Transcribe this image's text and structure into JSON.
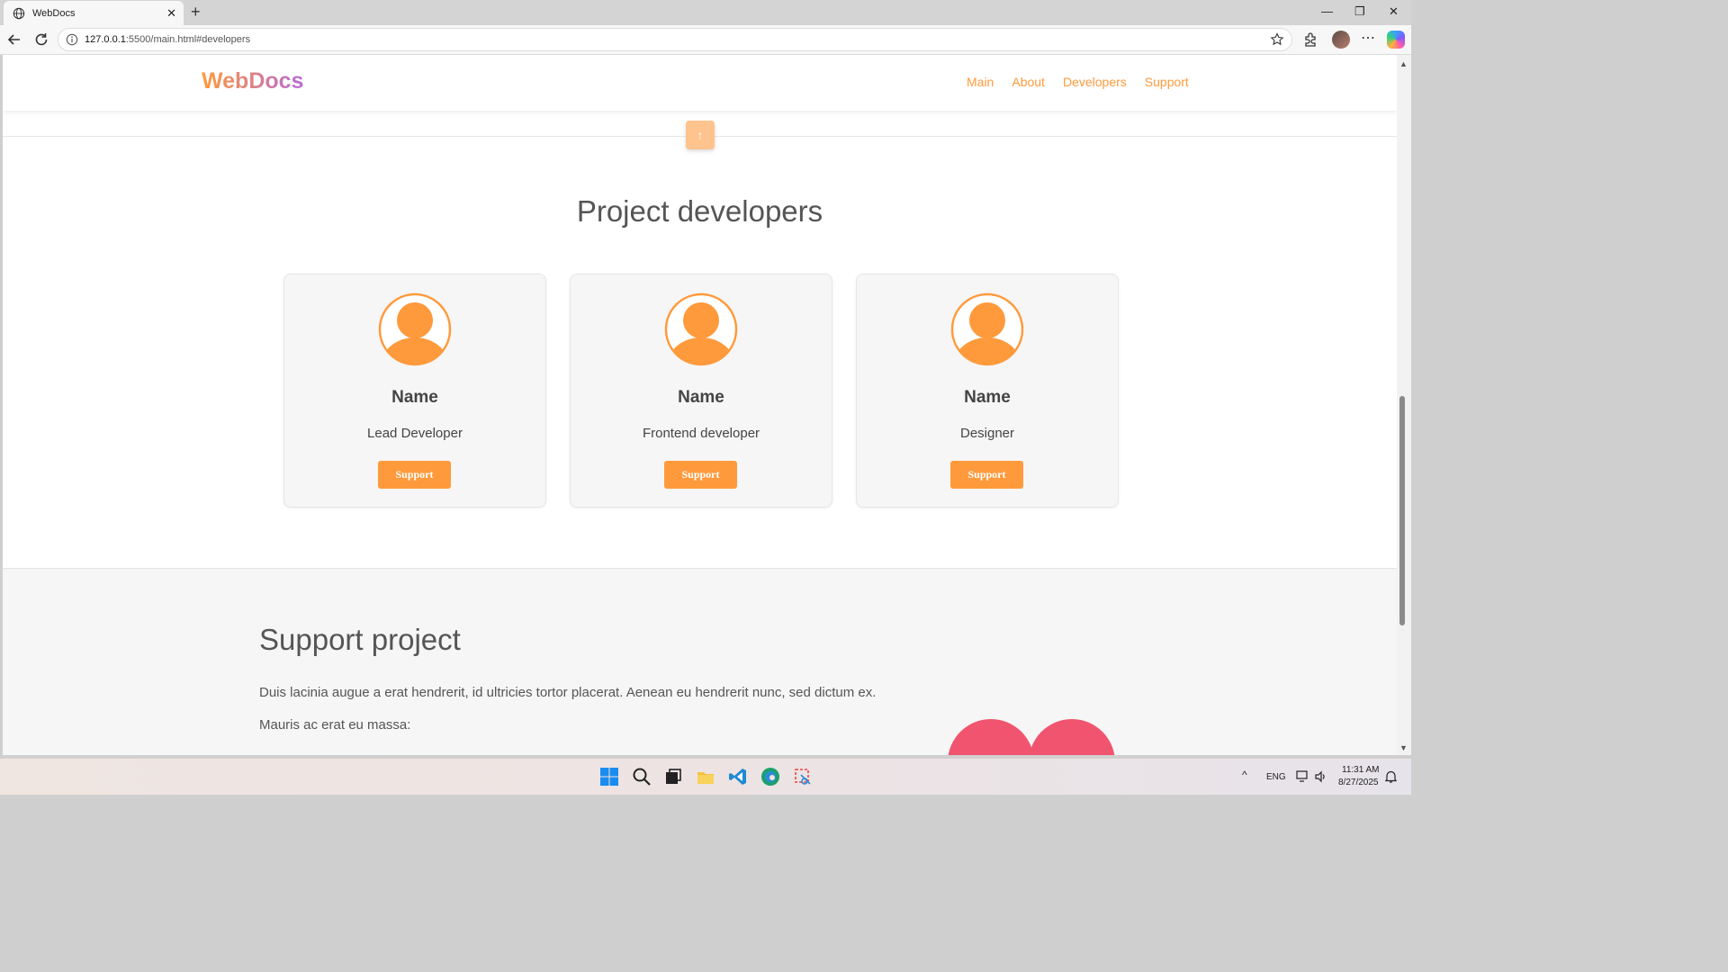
{
  "browser": {
    "tab_title": "WebDocs",
    "url_host": "127.0.0.1",
    "url_path": ":5500/main.html#developers"
  },
  "site": {
    "logo": "WebDocs",
    "nav": [
      "Main",
      "About",
      "Developers",
      "Support"
    ],
    "to_top": "↑"
  },
  "developers": {
    "title": "Project developers",
    "cards": [
      {
        "name": "Name",
        "role": "Lead Developer",
        "button": "Support"
      },
      {
        "name": "Name",
        "role": "Frontend developer",
        "button": "Support"
      },
      {
        "name": "Name",
        "role": "Designer",
        "button": "Support"
      }
    ]
  },
  "support": {
    "title": "Support project",
    "paragraph1": "Duis lacinia augue a erat hendrerit, id ultricies tortor placerat. Aenean eu hendrerit nunc, sed dictum ex.",
    "paragraph2": "Mauris ac erat eu massa:"
  },
  "taskbar": {
    "language": "ENG",
    "time": "11:31 AM",
    "date": "8/27/2025"
  },
  "colors": {
    "accent": "#ff9a3c",
    "heart": "#f0546e"
  }
}
